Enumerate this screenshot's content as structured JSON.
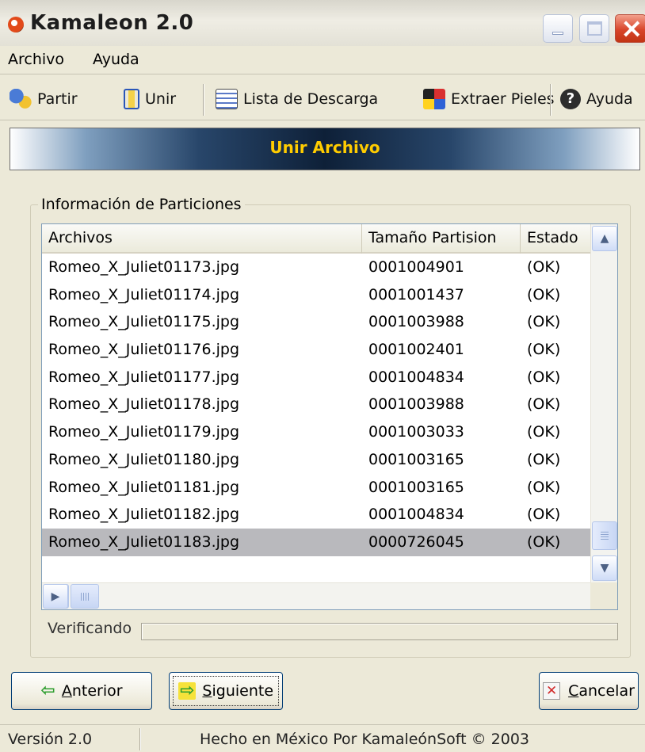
{
  "window": {
    "title": "Kamaleon 2.0"
  },
  "menu": {
    "archivo": "Archivo",
    "ayuda": "Ayuda"
  },
  "toolbar": {
    "partir": "Partir",
    "unir": "Unir",
    "lista": "Lista de Descarga",
    "extraer": "Extraer Pieles",
    "ayuda": "Ayuda"
  },
  "banner": {
    "title": "Unir Archivo"
  },
  "group": {
    "label": "Información de Particiones"
  },
  "table": {
    "columns": [
      "Archivos",
      "Tamaño Partision",
      "Estado"
    ],
    "rows": [
      [
        "Romeo_X_Juliet01173.jpg",
        "0001004901",
        "(OK)"
      ],
      [
        "Romeo_X_Juliet01174.jpg",
        "0001001437",
        "(OK)"
      ],
      [
        "Romeo_X_Juliet01175.jpg",
        "0001003988",
        "(OK)"
      ],
      [
        "Romeo_X_Juliet01176.jpg",
        "0001002401",
        "(OK)"
      ],
      [
        "Romeo_X_Juliet01177.jpg",
        "0001004834",
        "(OK)"
      ],
      [
        "Romeo_X_Juliet01178.jpg",
        "0001003988",
        "(OK)"
      ],
      [
        "Romeo_X_Juliet01179.jpg",
        "0001003033",
        "(OK)"
      ],
      [
        "Romeo_X_Juliet01180.jpg",
        "0001003165",
        "(OK)"
      ],
      [
        "Romeo_X_Juliet01181.jpg",
        "0001003165",
        "(OK)"
      ],
      [
        "Romeo_X_Juliet01182.jpg",
        "0001004834",
        "(OK)"
      ],
      [
        "Romeo_X_Juliet01183.jpg",
        "0000726045",
        "(OK)"
      ]
    ],
    "selected_row_index": 10
  },
  "status": {
    "verificando": "Verificando"
  },
  "buttons": {
    "anterior_first": "A",
    "anterior_rest": "nterior",
    "siguiente_first": "S",
    "siguiente_rest": "iguiente",
    "cancelar_first": "C",
    "cancelar_rest": "ancelar"
  },
  "statusbar": {
    "version": "Versión 2.0",
    "made": "Hecho en México Por KamaleónSoft © 2003"
  },
  "colors": {
    "banner_text": "#ffcc00",
    "selected_row": "#b9b9bd",
    "title_close": "#d8452a"
  }
}
